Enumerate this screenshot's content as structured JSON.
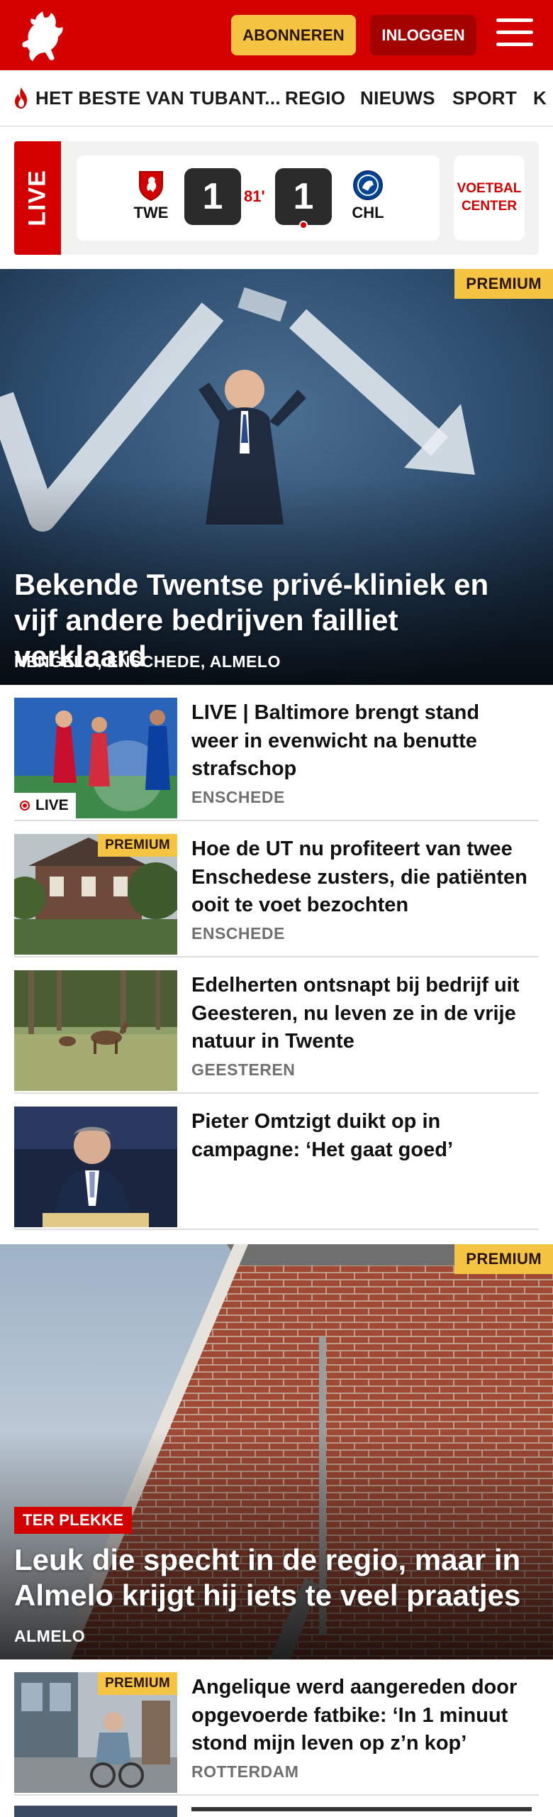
{
  "header": {
    "subscribe_label": "ABONNEREN",
    "login_label": "INLOGGEN",
    "logo_icon": "tubantia-horse-logo",
    "menu_icon": "hamburger-menu-icon",
    "brand_color": "#d40000"
  },
  "nav": {
    "items": [
      {
        "label": "HET BESTE VAN TUBANT...",
        "icon": "flame-icon"
      },
      {
        "label": "REGIO"
      },
      {
        "label": "NIEUWS"
      },
      {
        "label": "SPORT"
      },
      {
        "label": "K"
      }
    ]
  },
  "live_match": {
    "tag": "LIVE",
    "home_team": "TWE",
    "home_score": "1",
    "minute": "81'",
    "away_score": "1",
    "away_team": "CHL",
    "center_label_line1": "VOETBAL",
    "center_label_line2": "CENTER"
  },
  "hero1": {
    "badge": "PREMIUM",
    "title": "Bekende Twentse privé-kliniek en vijf andere bedrijven failliet verklaard",
    "location": "HENGELO, ENSCHEDE, ALMELO"
  },
  "articles": [
    {
      "title": "LIVE | Baltimore brengt stand weer in evenwicht na benutte strafschop",
      "location": "ENSCHEDE",
      "pill": "LIVE"
    },
    {
      "title": "Hoe de UT nu profiteert van twee Enschedese zusters, die patiënten ooit te voet bezochten",
      "location": "ENSCHEDE",
      "badge": "PREMIUM"
    },
    {
      "title": "Edelherten ontsnapt bij bedrijf uit Geesteren, nu leven ze in de vrije natuur in Twente",
      "location": "GEESTEREN"
    },
    {
      "title": "Pieter Omtzigt duikt op in campagne: ‘Het gaat goed’"
    }
  ],
  "hero2": {
    "badge": "PREMIUM",
    "kicker": "TER PLEKKE",
    "title": "Leuk die specht in de regio, maar in Almelo krijgt hij iets te veel praatjes",
    "location": "ALMELO"
  },
  "articles2": [
    {
      "title": "Angelique werd aangereden door opgevoerde fatbike: ‘In 1 minuut stond mijn leven op z’n kop’",
      "location": "ROTTERDAM",
      "badge": "PREMIUM"
    }
  ]
}
